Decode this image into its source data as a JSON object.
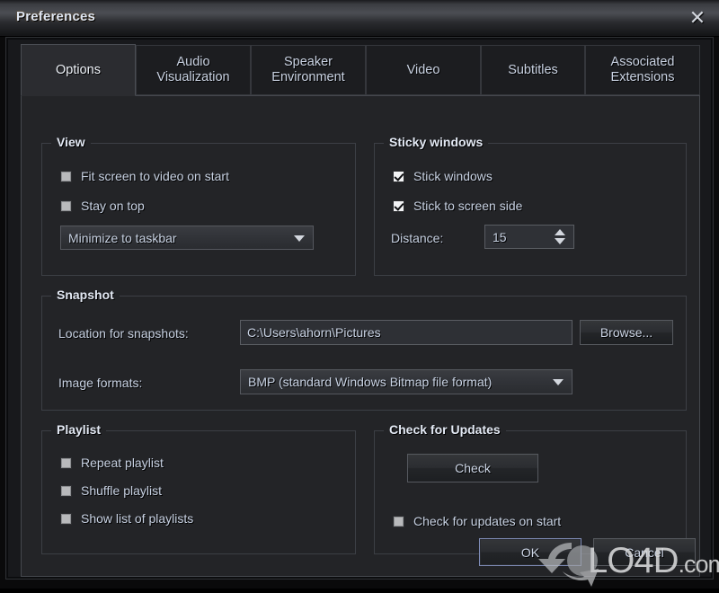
{
  "window": {
    "title": "Preferences",
    "close_icon": "close-icon"
  },
  "tabs": [
    {
      "label": "Options",
      "active": true
    },
    {
      "label": "Audio\nVisualization",
      "active": false
    },
    {
      "label": "Speaker\nEnvironment",
      "active": false
    },
    {
      "label": "Video",
      "active": false
    },
    {
      "label": "Subtitles",
      "active": false
    },
    {
      "label": "Associated\nExtensions",
      "active": false
    }
  ],
  "groups": {
    "view": {
      "title": "View",
      "checkboxes": [
        {
          "label": "Fit screen to video on start",
          "checked": false
        },
        {
          "label": "Stay on top",
          "checked": false
        }
      ],
      "minimize_combo": {
        "value": "Minimize to taskbar",
        "arrow_icon": "chevron-down-icon"
      }
    },
    "sticky": {
      "title": "Sticky windows",
      "checkboxes": [
        {
          "label": "Stick windows",
          "checked": true
        },
        {
          "label": "Stick to screen side",
          "checked": true
        }
      ],
      "distance_label": "Distance:",
      "distance_value": "15"
    },
    "snapshot": {
      "title": "Snapshot",
      "location_label": "Location for snapshots:",
      "location_value": "C:\\Users\\ahorn\\Pictures",
      "browse_label": "Browse...",
      "formats_label": "Image formats:",
      "formats_value": "BMP (standard Windows Bitmap file format)"
    },
    "playlist": {
      "title": "Playlist",
      "checkboxes": [
        {
          "label": "Repeat playlist",
          "checked": false
        },
        {
          "label": "Shuffle playlist",
          "checked": false
        },
        {
          "label": "Show list of playlists",
          "checked": false
        }
      ]
    },
    "updates": {
      "title": "Check for Updates",
      "check_button": "Check",
      "checkbox": {
        "label": "Check for updates on start",
        "checked": false
      }
    }
  },
  "footer": {
    "ok_label": "OK",
    "cancel_label": "Cancel"
  },
  "watermark": {
    "text": "LO4D",
    "suffix": ".com"
  },
  "colors": {
    "dialog_bg": "#232427",
    "titlebar_light": "#4c4e54",
    "text": "#c7d1e2",
    "focus_border": "#7e8bb5"
  }
}
